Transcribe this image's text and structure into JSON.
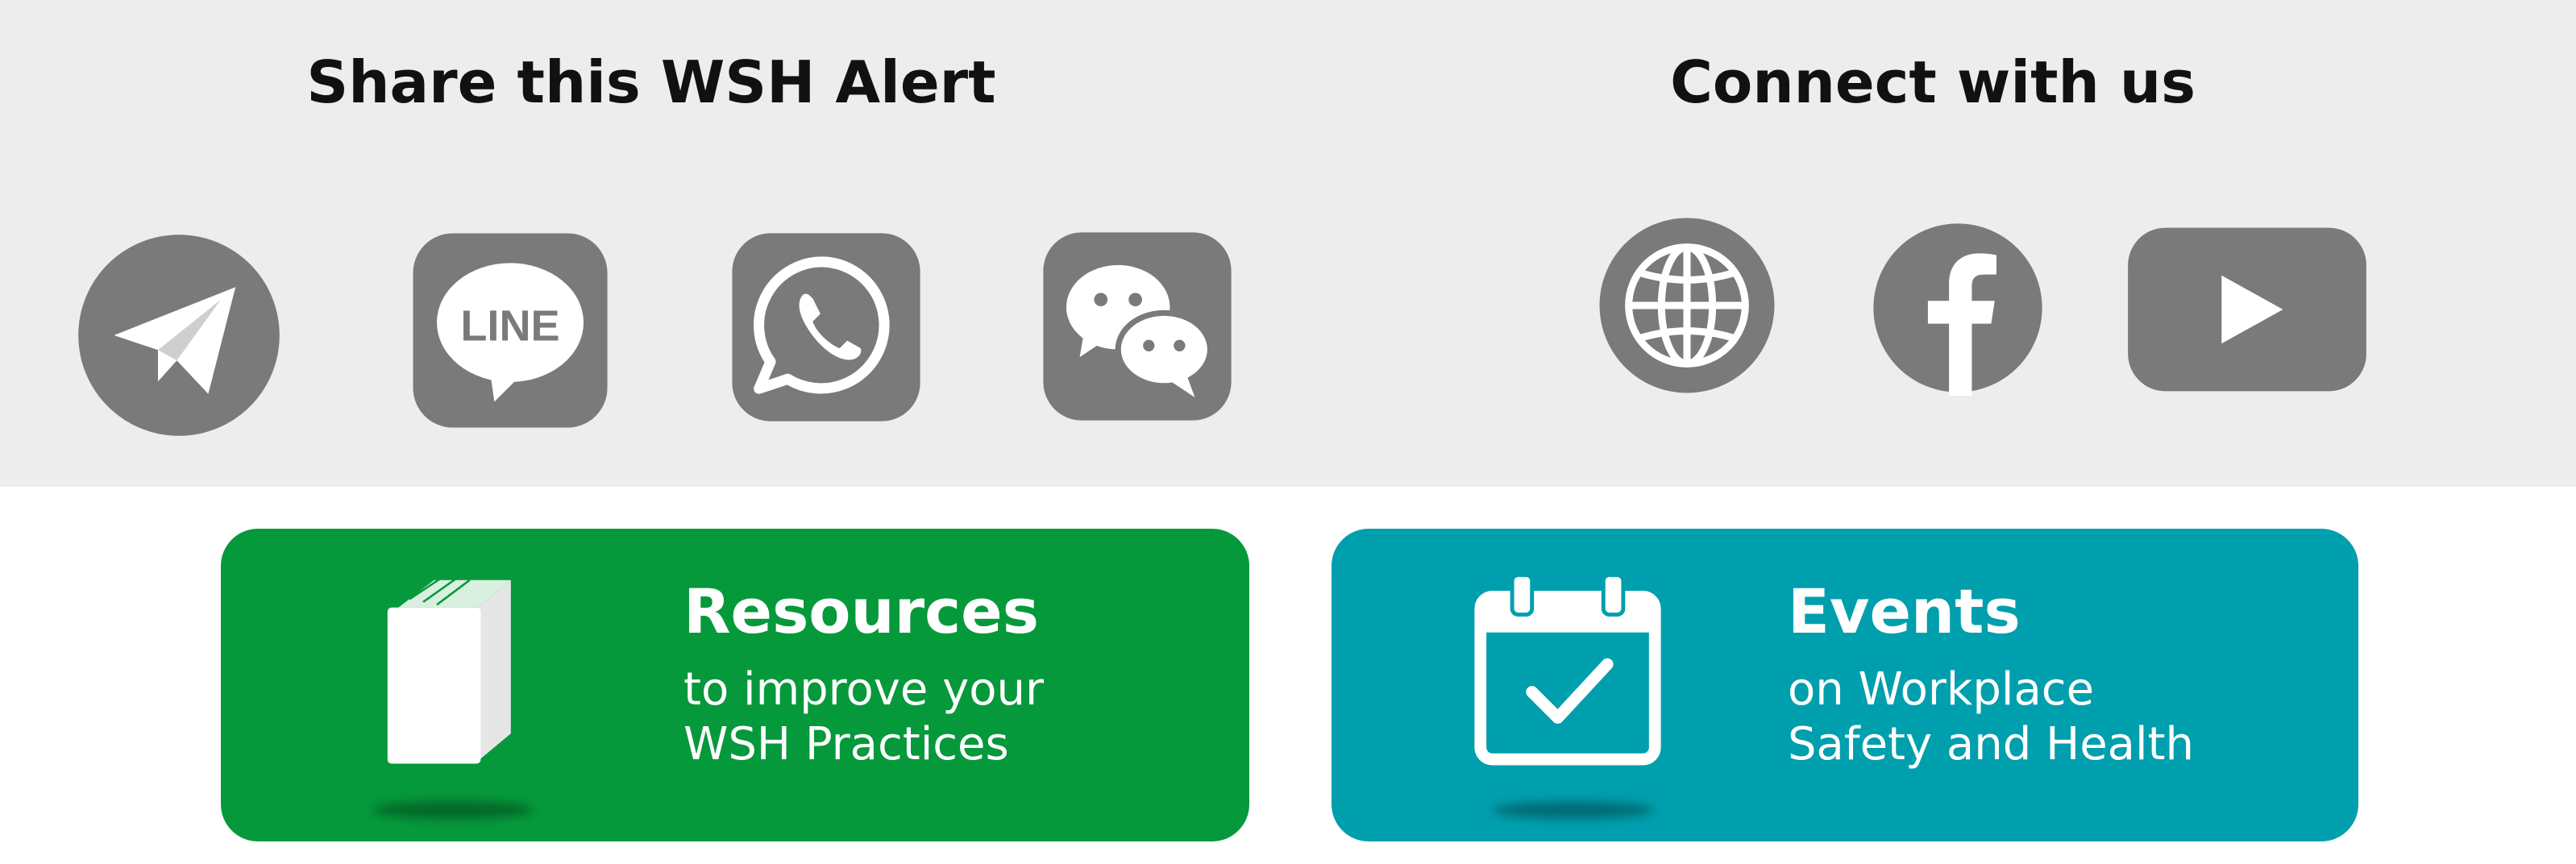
{
  "share": {
    "heading": "Share this WSH Alert",
    "icons": [
      "telegram-icon",
      "line-icon",
      "whatsapp-icon",
      "wechat-icon"
    ],
    "line_text": "LINE"
  },
  "connect": {
    "heading": "Connect with us",
    "icons": [
      "globe-icon",
      "facebook-icon",
      "youtube-icon"
    ]
  },
  "cards": {
    "resources": {
      "title": "Resources",
      "line1": "to improve your",
      "line2": "WSH Practices",
      "color": "#06993b",
      "icon": "book-icon"
    },
    "events": {
      "title": "Events",
      "line1": "on Workplace",
      "line2": "Safety and Health",
      "color": "#009fae",
      "icon": "calendar-check-icon"
    }
  },
  "colors": {
    "band": "#ededed",
    "icon_gray": "#7a7a7a"
  }
}
